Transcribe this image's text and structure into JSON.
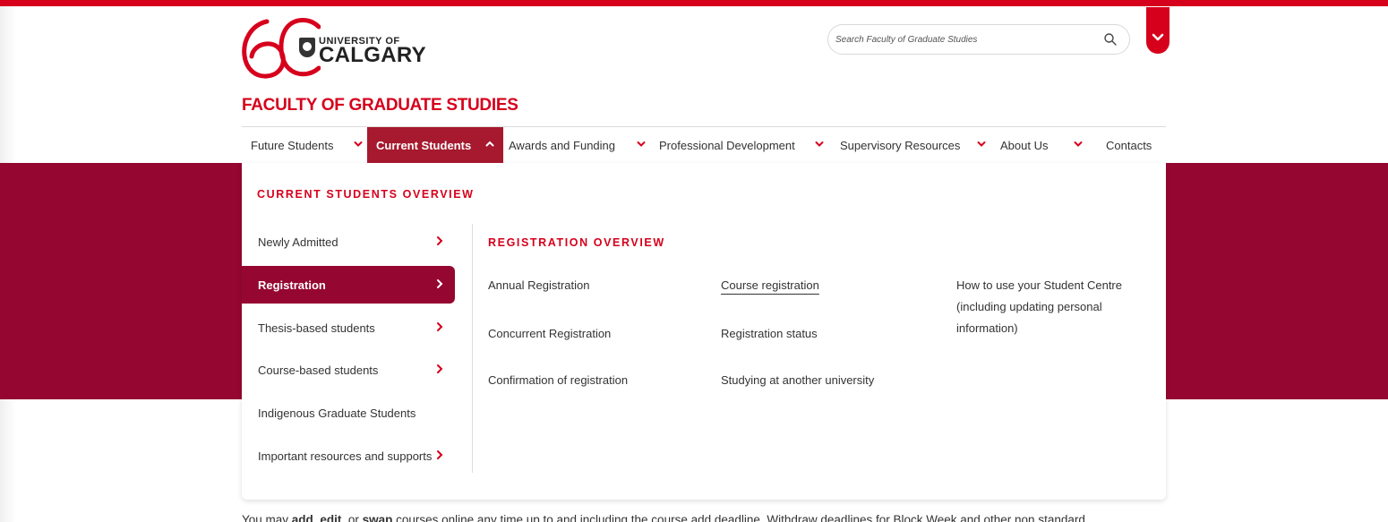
{
  "header": {
    "logo_number": "60",
    "university_of": "UNIVERSITY OF",
    "university_name": "CALGARY",
    "faculty_title": "FACULTY OF GRADUATE STUDIES",
    "search_placeholder": "Search Faculty of Graduate Studies"
  },
  "nav": {
    "items": [
      {
        "label": "Future Students",
        "expanded": false
      },
      {
        "label": "Current Students",
        "expanded": true
      },
      {
        "label": "Awards and Funding",
        "expanded": false
      },
      {
        "label": "Professional Development",
        "expanded": false
      },
      {
        "label": "Supervisory Resources",
        "expanded": false
      },
      {
        "label": "About Us",
        "expanded": false
      },
      {
        "label": "Contacts",
        "expanded": false
      }
    ]
  },
  "dropdown": {
    "overview_label": "CURRENT STUDENTS OVERVIEW",
    "left_items": [
      {
        "label": "Newly Admitted",
        "has_submenu": true
      },
      {
        "label": "Registration",
        "has_submenu": true,
        "active": true
      },
      {
        "label": "Thesis-based students",
        "has_submenu": true
      },
      {
        "label": "Course-based students",
        "has_submenu": true
      },
      {
        "label": "Indigenous Graduate Students",
        "has_submenu": false
      },
      {
        "label": "Important resources and supports",
        "has_submenu": true
      }
    ],
    "sub_overview_label": "REGISTRATION OVERVIEW",
    "sub_links": {
      "col1": [
        "Annual Registration",
        "Concurrent Registration",
        "Confirmation of registration"
      ],
      "col2": [
        "Course registration",
        "Registration status",
        "Studying at another university"
      ],
      "col3": [
        "How to use your Student Centre (including updating personal information)"
      ]
    }
  },
  "body": {
    "seg1": "You may ",
    "bold1": "add",
    "seg2": ", ",
    "bold2": "edit",
    "seg3": ", or ",
    "bold3": "swap",
    "seg4": " courses online any time up to and including the course add deadline. Withdraw deadlines for Block Week and other non standard"
  },
  "colors": {
    "brand_red": "#d6001c",
    "hero_maroon": "#950630",
    "active_tab": "#a6192e"
  }
}
